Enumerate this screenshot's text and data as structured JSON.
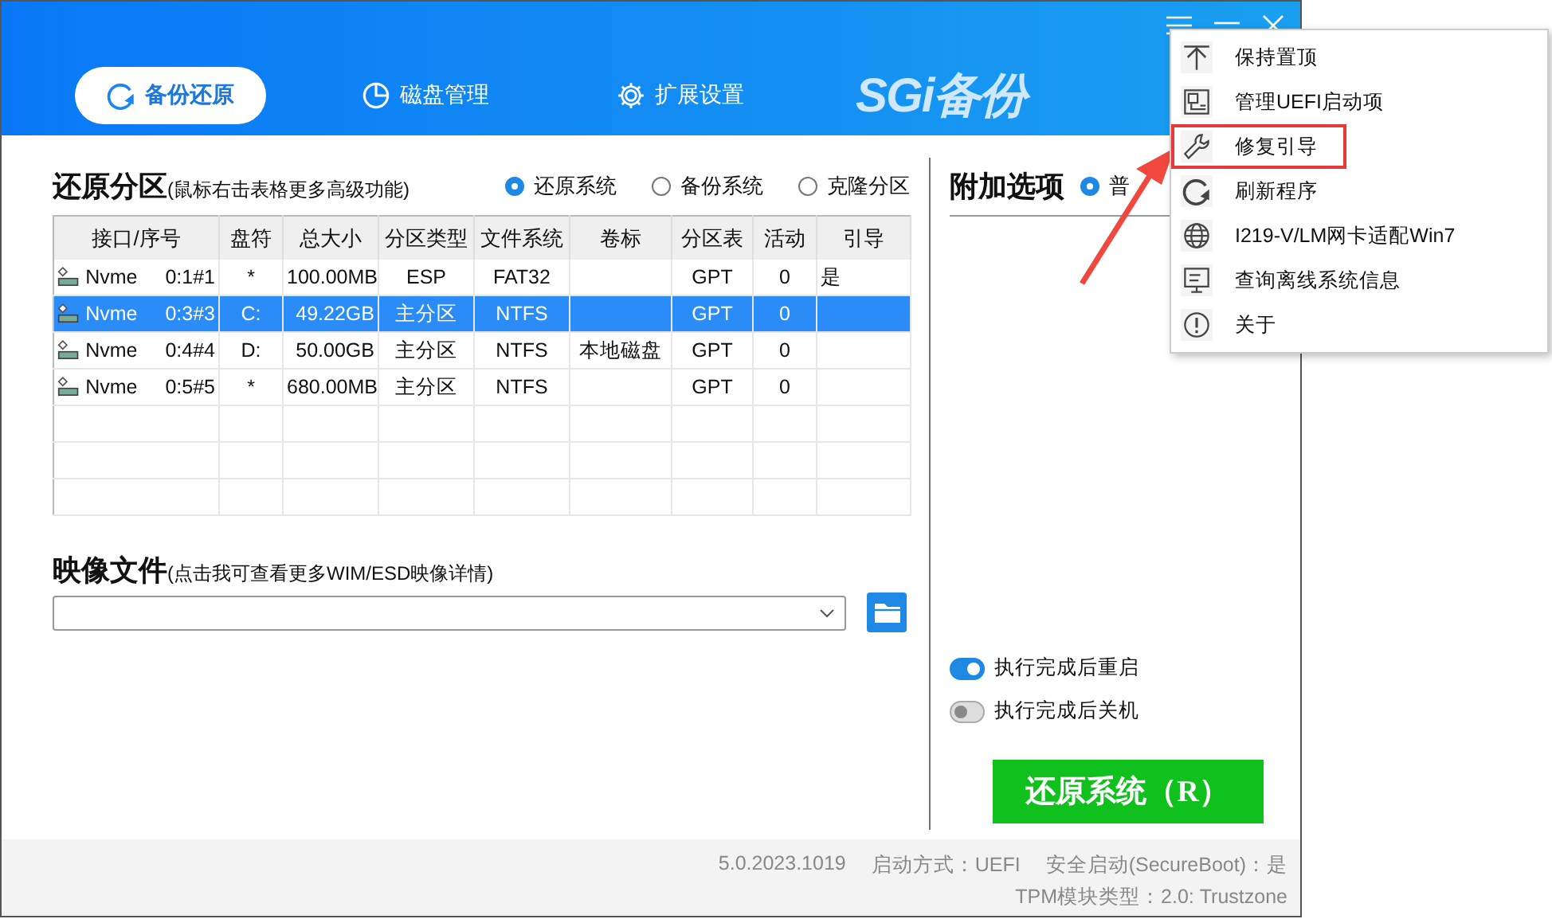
{
  "tabs": [
    {
      "label": "备份还原",
      "selected": true
    },
    {
      "label": "磁盘管理",
      "selected": false
    },
    {
      "label": "扩展设置",
      "selected": false
    }
  ],
  "logo": "SGi备份",
  "restore": {
    "title": "还原分区",
    "hint": "(鼠标右击表格更多高级功能)",
    "modes": [
      {
        "label": "还原系统",
        "selected": true
      },
      {
        "label": "备份系统",
        "selected": false
      },
      {
        "label": "克隆分区",
        "selected": false
      }
    ],
    "table": {
      "columns": [
        "接口/序号",
        "盘符",
        "总大小",
        "分区类型",
        "文件系统",
        "卷标",
        "分区表",
        "活动",
        "引导"
      ],
      "rows": [
        {
          "selected": false,
          "cells": [
            "Nvme 0:1#1",
            "*",
            "100.00MB",
            "ESP",
            "FAT32",
            "",
            "GPT",
            "0",
            "是"
          ]
        },
        {
          "selected": true,
          "cells": [
            "Nvme 0:3#3",
            "C:",
            "49.22GB",
            "主分区",
            "NTFS",
            "",
            "GPT",
            "0",
            ""
          ]
        },
        {
          "selected": false,
          "cells": [
            "Nvme 0:4#4",
            "D:",
            "50.00GB",
            "主分区",
            "NTFS",
            "本地磁盘",
            "GPT",
            "0",
            ""
          ]
        },
        {
          "selected": false,
          "cells": [
            "Nvme 0:5#5",
            "*",
            "680.00MB",
            "主分区",
            "NTFS",
            "",
            "GPT",
            "0",
            ""
          ]
        }
      ]
    }
  },
  "image": {
    "title": "映像文件",
    "hint": "(点击我可查看更多WIM/ESD映像详情)"
  },
  "options": {
    "title": "附加选项",
    "mode": {
      "label": "普",
      "selected": true
    },
    "toggles": [
      {
        "label": "执行完成后重启",
        "on": true
      },
      {
        "label": "执行完成后关机",
        "on": false
      }
    ],
    "action": "还原系统（R）"
  },
  "status_bar": [
    "5.0.2023.1019",
    "启动方式：UEFI",
    "安全启动(SecureBoot)：是",
    "TPM模块类型：2.0: Trustzone"
  ],
  "menu": [
    {
      "label": "保持置顶",
      "highlighted": false
    },
    {
      "label": "管理UEFI启动项",
      "highlighted": false
    },
    {
      "label": "修复引导",
      "highlighted": true
    },
    {
      "label": "刷新程序",
      "highlighted": false
    },
    {
      "label": "I219-V/LM网卡适配Win7",
      "highlighted": false
    },
    {
      "label": "查询离线系统信息",
      "highlighted": false
    },
    {
      "label": "关于",
      "highlighted": false
    }
  ]
}
